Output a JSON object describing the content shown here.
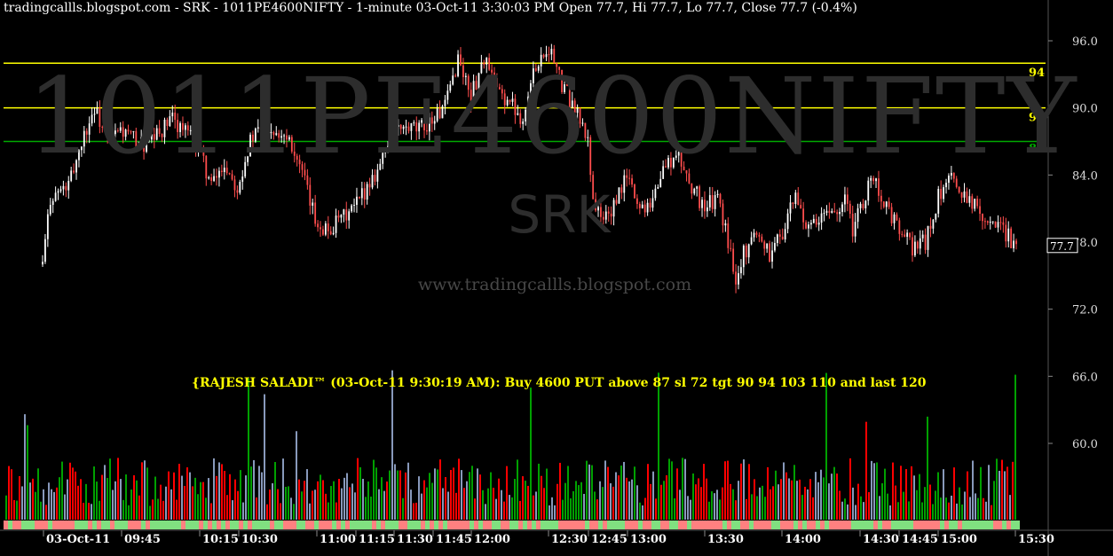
{
  "header": "tradingcallls.blogspot.com - SRK - 1011PE4600NIFTY - 1-minute 03-Oct-11 3:30:03 PM Open 77.7, Hi 77.7, Lo 77.7, Close 77.7 (-0.4%)",
  "watermark": {
    "symbol": "1011PE4600NIFTY",
    "ticker": "SRK",
    "site": "www.tradingcallls.blogspot.com"
  },
  "annotation": "{RAJESH SALADI™ (03-Oct-11 9:30:19 AM): Buy 4600 PUT above 87 sl 72 tgt 90 94 103 110 and last 120",
  "colors": {
    "background": "#000000",
    "up_candle": "#ffffff",
    "down_candle": "#ff4d4d",
    "target_line": "#ffff00",
    "entry_line": "#00aa00",
    "vol_up": "#00a000",
    "vol_down": "#ff0000",
    "vol_neutral": "#8899bb"
  },
  "chart_data": {
    "type": "candlestick",
    "interval": "1-minute",
    "date": "03-Oct-11",
    "last_close": 77.7,
    "ylim": [
      70,
      98
    ],
    "y_ticks": [
      "96.0",
      "90.0",
      "84.0",
      "78.0",
      "72.0",
      "66.0",
      "60.0"
    ],
    "last_price_label": "77.7",
    "x_ticks": [
      "03-Oct-11",
      "09:45",
      "10:15",
      "10:30",
      "11:00",
      "11:15",
      "11:30",
      "11:45",
      "12:00",
      "12:30",
      "12:45",
      "13:00",
      "13:30",
      "14:00",
      "14:30",
      "14:45",
      "15:00",
      "15:30"
    ],
    "levels": [
      {
        "label": "94",
        "value": 94,
        "color": "#ffff00"
      },
      {
        "label": "90",
        "value": 90,
        "color": "#ffff00"
      },
      {
        "label": "87",
        "value": 87,
        "color": "#00aa00"
      }
    ],
    "price_series": [
      {
        "time": "09:15",
        "close": 76.0
      },
      {
        "time": "09:18",
        "close": 82.0
      },
      {
        "time": "09:25",
        "close": 83.0
      },
      {
        "time": "09:30",
        "close": 87.0
      },
      {
        "time": "09:35",
        "close": 90.0
      },
      {
        "time": "09:40",
        "close": 87.0
      },
      {
        "time": "09:45",
        "close": 88.0
      },
      {
        "time": "09:55",
        "close": 86.5
      },
      {
        "time": "10:05",
        "close": 89.0
      },
      {
        "time": "10:10",
        "close": 88.0
      },
      {
        "time": "10:15",
        "close": 86.5
      },
      {
        "time": "10:20",
        "close": 83.0
      },
      {
        "time": "10:25",
        "close": 85.0
      },
      {
        "time": "10:30",
        "close": 83.0
      },
      {
        "time": "10:35",
        "close": 87.0
      },
      {
        "time": "10:40",
        "close": 88.5
      },
      {
        "time": "10:50",
        "close": 87.5
      },
      {
        "time": "10:55",
        "close": 84.0
      },
      {
        "time": "11:00",
        "close": 80.0
      },
      {
        "time": "11:05",
        "close": 79.0
      },
      {
        "time": "11:15",
        "close": 81.0
      },
      {
        "time": "11:25",
        "close": 85.0
      },
      {
        "time": "11:30",
        "close": 88.0
      },
      {
        "time": "11:40",
        "close": 88.0
      },
      {
        "time": "11:45",
        "close": 89.0
      },
      {
        "time": "11:50",
        "close": 90.0
      },
      {
        "time": "11:55",
        "close": 94.5
      },
      {
        "time": "12:00",
        "close": 91.0
      },
      {
        "time": "12:05",
        "close": 94.5
      },
      {
        "time": "12:10",
        "close": 91.5
      },
      {
        "time": "12:15",
        "close": 90.5
      },
      {
        "time": "12:20",
        "close": 89.0
      },
      {
        "time": "12:25",
        "close": 94.0
      },
      {
        "time": "12:30",
        "close": 95.5
      },
      {
        "time": "12:35",
        "close": 92.0
      },
      {
        "time": "12:40",
        "close": 90.0
      },
      {
        "time": "12:45",
        "close": 87.0
      },
      {
        "time": "12:47",
        "close": 82.0
      },
      {
        "time": "12:50",
        "close": 80.0
      },
      {
        "time": "12:55",
        "close": 81.0
      },
      {
        "time": "13:00",
        "close": 84.0
      },
      {
        "time": "13:05",
        "close": 81.0
      },
      {
        "time": "13:10",
        "close": 82.0
      },
      {
        "time": "13:15",
        "close": 85.0
      },
      {
        "time": "13:20",
        "close": 85.5
      },
      {
        "time": "13:25",
        "close": 83.0
      },
      {
        "time": "13:30",
        "close": 81.0
      },
      {
        "time": "13:35",
        "close": 82.0
      },
      {
        "time": "13:40",
        "close": 77.0
      },
      {
        "time": "13:42",
        "close": 75.0
      },
      {
        "time": "13:45",
        "close": 77.0
      },
      {
        "time": "13:50",
        "close": 79.0
      },
      {
        "time": "13:55",
        "close": 77.0
      },
      {
        "time": "14:00",
        "close": 79.0
      },
      {
        "time": "14:05",
        "close": 82.0
      },
      {
        "time": "14:10",
        "close": 79.0
      },
      {
        "time": "14:15",
        "close": 80.0
      },
      {
        "time": "14:20",
        "close": 81.0
      },
      {
        "time": "14:25",
        "close": 82.0
      },
      {
        "time": "14:27",
        "close": 79.0
      },
      {
        "time": "14:30",
        "close": 81.0
      },
      {
        "time": "14:35",
        "close": 84.0
      },
      {
        "time": "14:40",
        "close": 81.0
      },
      {
        "time": "14:45",
        "close": 79.0
      },
      {
        "time": "14:50",
        "close": 77.5
      },
      {
        "time": "14:55",
        "close": 78.0
      },
      {
        "time": "15:00",
        "close": 82.0
      },
      {
        "time": "15:05",
        "close": 83.5
      },
      {
        "time": "15:10",
        "close": 82.5
      },
      {
        "time": "15:15",
        "close": 81.0
      },
      {
        "time": "15:20",
        "close": 80.0
      },
      {
        "time": "15:25",
        "close": 79.0
      },
      {
        "time": "15:30",
        "close": 77.7
      }
    ]
  }
}
